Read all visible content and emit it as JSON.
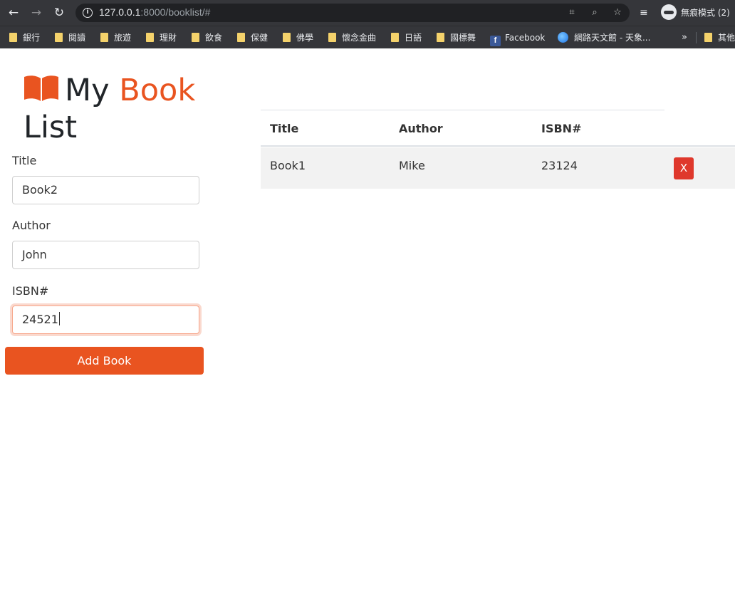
{
  "browser": {
    "url_host": "127.0.0.1",
    "url_path": ":8000/booklist/#",
    "profile_label": "無痕模式 (2)",
    "bookmarks": [
      {
        "label": "銀行",
        "icon": "folder-icon"
      },
      {
        "label": "閱讀",
        "icon": "folder-icon"
      },
      {
        "label": "旅遊",
        "icon": "folder-icon"
      },
      {
        "label": "理財",
        "icon": "folder-icon"
      },
      {
        "label": "飲食",
        "icon": "folder-icon"
      },
      {
        "label": "保健",
        "icon": "folder-icon"
      },
      {
        "label": "佛學",
        "icon": "folder-icon"
      },
      {
        "label": "懷念金曲",
        "icon": "folder-icon"
      },
      {
        "label": "日語",
        "icon": "folder-icon"
      },
      {
        "label": "國標舞",
        "icon": "folder-icon"
      },
      {
        "label": "Facebook",
        "icon": "facebook-icon"
      },
      {
        "label": "網路天文館 - 天象...",
        "icon": "globe-icon"
      }
    ],
    "more_bookmarks": "»",
    "other_bookmarks": "其他"
  },
  "app": {
    "title_part1": "My",
    "title_part2": "Book",
    "title_part3": "List",
    "accent_color": "#e95420"
  },
  "form": {
    "title_label": "Title",
    "title_value": "Book2",
    "author_label": "Author",
    "author_value": "John",
    "isbn_label": "ISBN#",
    "isbn_value": "24521",
    "submit_label": "Add Book"
  },
  "table": {
    "headers": [
      "Title",
      "Author",
      "ISBN#"
    ],
    "rows": [
      {
        "title": "Book1",
        "author": "Mike",
        "isbn": "23124",
        "delete_label": "X"
      }
    ]
  }
}
